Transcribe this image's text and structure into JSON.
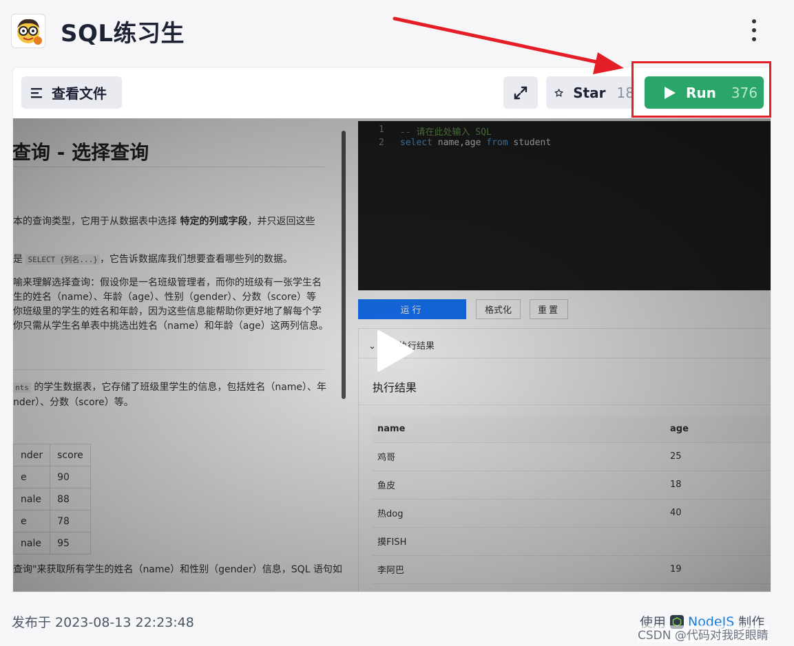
{
  "header": {
    "title": "SQL练习生"
  },
  "toolbar": {
    "files_label": "查看文件",
    "star_label": "Star",
    "star_count": "18",
    "run_label": "Run",
    "run_count": "376"
  },
  "doc": {
    "heading": "查询 - 选择查询",
    "p1_a": "本的查询类型，它用于从数据表中选择 ",
    "p1_b": "特定的列或字段",
    "p1_c": "，并只返回这些",
    "p2_a": "是 ",
    "p2_code": "SELECT {列名...}",
    "p2_b": "，它告诉数据库我们想要查看哪些列的数据。",
    "p3": "喻来理解选择查询：假设你是一名班级管理者，而你的班级有一张学生名",
    "p4": "生的姓名（name）、年龄（age）、性别（gender）、分数（score）等",
    "p5": "你班级里的学生的姓名和年龄，因为这些信息能帮助你更好地了解每个学",
    "p6": "你只需从学生名单表中挑选出姓名（name）和年龄（age）这两列信息。",
    "p7_code": "nts",
    "p7": "的学生数据表，它存储了班级里学生的信息，包括姓名（name）、年",
    "p8": "nder）、分数（score）等。",
    "table_headers": [
      "nder",
      "score"
    ],
    "table_rows": [
      [
        "e",
        "90"
      ],
      [
        "nale",
        "88"
      ],
      [
        "e",
        "78"
      ],
      [
        "nale",
        "95"
      ]
    ],
    "p9": "查询\"来获取所有学生的姓名（name）和性别（gender）信息，SQL 语句如"
  },
  "editor": {
    "line_numbers": [
      "1",
      "2"
    ],
    "line1": "-- 请在此处输入 SQL",
    "line2_kw1": "select",
    "line2_id1": " name,age ",
    "line2_kw2": "from",
    "line2_id2": " student"
  },
  "controls": {
    "run": "运行",
    "format": "格式化",
    "reset": "重置"
  },
  "results": {
    "collapse_label": "执行结果",
    "title": "执行结果",
    "columns": [
      "name",
      "age"
    ],
    "rows": [
      [
        "鸡哥",
        "25"
      ],
      [
        "鱼皮",
        "18"
      ],
      [
        "热dog",
        "40"
      ],
      [
        "摸FISH",
        ""
      ],
      [
        "李阿巴",
        "19"
      ]
    ]
  },
  "footer": {
    "published": "发布于 2023-08-13 22:23:48",
    "made_prefix": "使用",
    "made_link": "NodeJS",
    "made_suffix": "制作",
    "watermark": "CSDN @代码对我眨眼睛"
  },
  "colors": {
    "run_button": "#2ba66b",
    "annotation": "#e41e26",
    "link": "#1c7ed6"
  },
  "icons": [
    "avatar",
    "menu-icon",
    "expand-icon",
    "star-icon",
    "play-icon",
    "more-vertical-icon",
    "nodejs-icon"
  ]
}
